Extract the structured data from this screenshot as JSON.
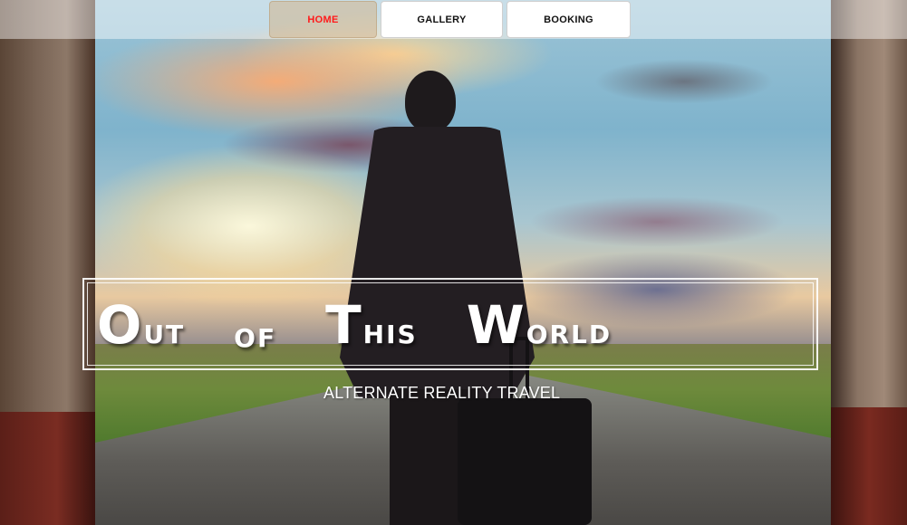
{
  "nav": {
    "items": [
      {
        "label": "HOME",
        "active": true
      },
      {
        "label": "GALLERY",
        "active": false
      },
      {
        "label": "BOOKING",
        "active": false
      }
    ]
  },
  "hero": {
    "title_words": [
      {
        "first": "O",
        "rest": "ut"
      },
      {
        "first": "",
        "rest": "of"
      },
      {
        "first": "T",
        "rest": "his"
      },
      {
        "first": "W",
        "rest": "orld"
      }
    ],
    "subtitle": "ALTERNATE REALITY TRAVEL"
  },
  "colors": {
    "active_nav_text": "#ff1a1a",
    "nav_text": "#111111",
    "title_text": "#ffffff"
  }
}
